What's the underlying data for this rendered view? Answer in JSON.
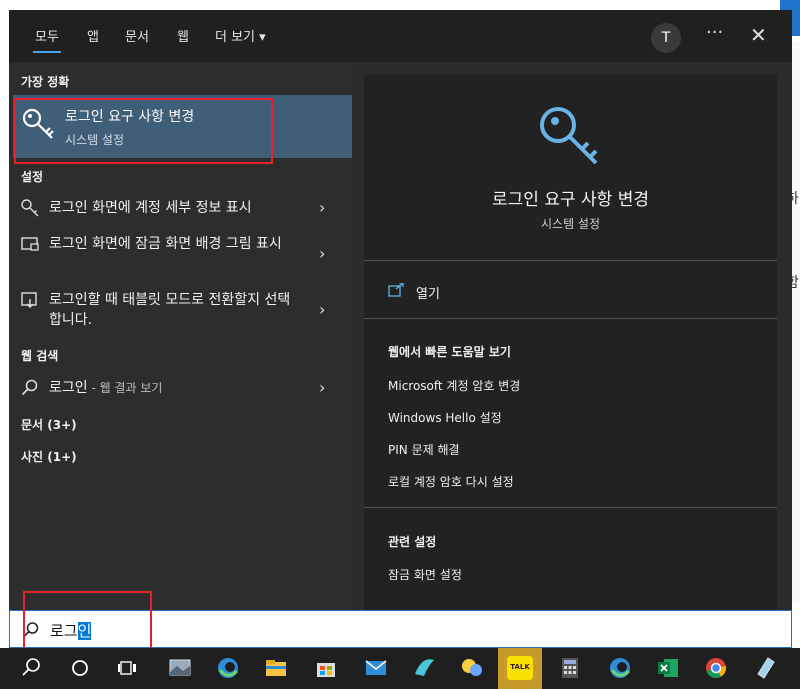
{
  "background": {
    "fragment_1": "-하",
    "fragment_2": "함"
  },
  "header": {
    "tabs": [
      {
        "label": "모두",
        "active": true
      },
      {
        "label": "앱"
      },
      {
        "label": "문서"
      },
      {
        "label": "웹"
      },
      {
        "label": "더 보기"
      }
    ],
    "more_chevron": "▾",
    "avatar_initial": "T",
    "more_icon": "···",
    "close_icon": "✕"
  },
  "left": {
    "best_match_heading": "가장 정확",
    "best_match": {
      "title": "로그인 요구 사항 변경",
      "subtitle": "시스템 설정",
      "icon": "key-icon"
    },
    "settings_heading": "설정",
    "settings_items": [
      {
        "label": "로그인 화면에 계정 세부 정보 표시",
        "icon": "key-icon"
      },
      {
        "label": "로그인 화면에 잠금 화면 배경 그림 표시",
        "icon": "lockscreen-icon"
      },
      {
        "label": "로그인할 때 태블릿 모드로 전환할지 선택합니다.",
        "icon": "tablet-mode-icon"
      }
    ],
    "web_heading": "웹 검색",
    "web_item": {
      "query": "로그인",
      "suffix": " - 웹 결과 보기",
      "icon": "search-icon"
    },
    "documents": "문서 (3+)",
    "photos": "사진 (1+)"
  },
  "right": {
    "title": "로그인 요구 사항 변경",
    "subtitle": "시스템 설정",
    "open": "열기",
    "help_heading": "웹에서 빠른 도움말 보기",
    "help_links": [
      "Microsoft 계정 암호 변경",
      "Windows Hello 설정",
      "PIN 문제 해결",
      "로컬 계정 암호 다시 설정"
    ],
    "related_heading": "관련 설정",
    "related_links": [
      "잠금 화면 설정"
    ]
  },
  "search": {
    "text_plain": "로그",
    "text_selected": "인"
  },
  "taskbar": {
    "icons": [
      "search-icon",
      "cortana-icon",
      "task-view-icon",
      "photos-app-icon",
      "edge-icon",
      "file-explorer-icon",
      "store-icon",
      "mail-icon",
      "app-icon",
      "chat-icon",
      "kakaotalk-icon",
      "calculator-icon",
      "edge-icon",
      "excel-icon",
      "chrome-icon",
      "notes-icon"
    ],
    "kakaotalk_label": "TALK"
  },
  "colors": {
    "accent": "#0078d7",
    "highlight_box": "#e8202b",
    "selection_bg": "#3f5f78",
    "panel_bg": "#2b2b2b"
  }
}
